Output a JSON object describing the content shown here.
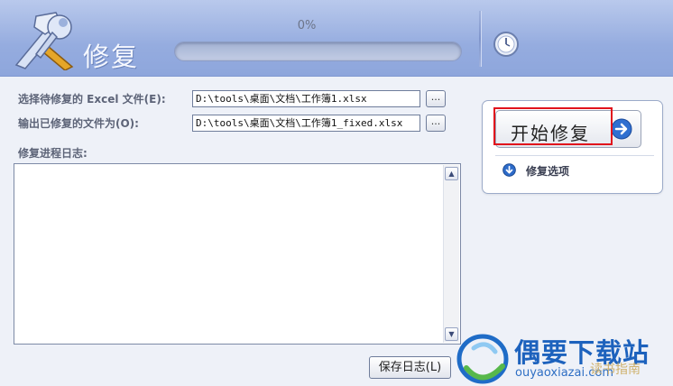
{
  "header": {
    "title": "修复",
    "progress_text": "0%",
    "progress_value": 0
  },
  "form": {
    "source_label": "选择待修复的 Excel 文件(E):",
    "source_value": "D:\\tools\\桌面\\文档\\工作簿1.xlsx",
    "output_label": "输出已修复的文件为(O):",
    "output_value": "D:\\tools\\桌面\\文档\\工作簿1_fixed.xlsx",
    "browse_label": "...",
    "log_label": "修复进程日志:",
    "save_log_label": "保存日志(L)"
  },
  "panel": {
    "start_label": "开始修复",
    "options_label": "修复选项"
  },
  "watermark": {
    "title": "偶要下载站",
    "url": "ouyaoxiazai.com",
    "note": "读书指南"
  },
  "colors": {
    "header_top": "#b9c9ec",
    "header_bottom": "#8ea6dc",
    "highlight": "#e1131c",
    "accent_blue": "#1d62bd"
  },
  "icons": {
    "logo": "hammer-wrench-icon",
    "clock": "clock-icon",
    "start": "arrow-right-circle-icon",
    "options": "arrow-down-circle-icon",
    "scroll_up": "scroll-up-icon",
    "scroll_down": "scroll-down-icon"
  }
}
